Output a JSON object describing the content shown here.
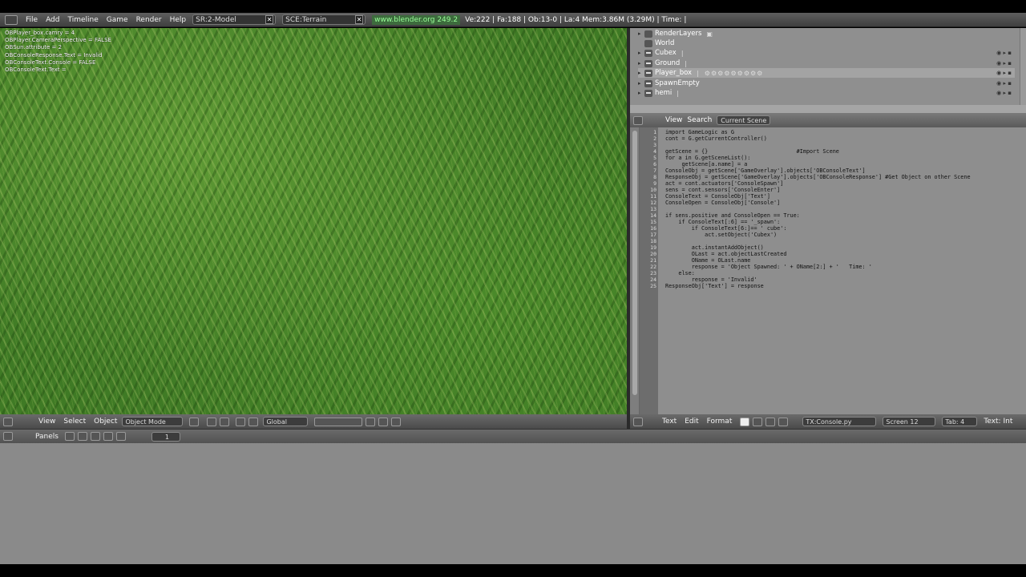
{
  "topbar": {
    "menus": [
      "File",
      "Add",
      "Timeline",
      "Game",
      "Render",
      "Help"
    ],
    "screen": "SR:2-Model",
    "scene": "SCE:Terrain",
    "url": "www.blender.org 249.2",
    "stats": "Ve:222 | Fa:188 | Ob:13-0 | La:4   Mem:3.86M (3.29M) | Time: |"
  },
  "viewport": {
    "debug_lines": [
      "OBPlayer_box.camry = 4",
      "OBPlayer.CameraPerspective = FALSE",
      "OBSun.attribute = 2",
      "OBConsoleResponse.Text = Invalid",
      "OBConsoleText.Console = FALSE",
      "OBConsoleText.Text ="
    ]
  },
  "outliner": {
    "items": [
      {
        "label": "RenderLayers",
        "extra": ""
      },
      {
        "label": "World",
        "extra": ""
      },
      {
        "label": "Cubex",
        "extra": "|"
      },
      {
        "label": "Ground",
        "extra": "|"
      },
      {
        "label": "Player_box",
        "extra": "|"
      },
      {
        "label": "SpawnEmpty",
        "extra": ""
      },
      {
        "label": "hemi",
        "extra": "|"
      }
    ]
  },
  "texteditor": {
    "header_buttons": [
      "View",
      "Search"
    ],
    "scope": "Current Scene",
    "lines": [
      {
        "n": "1",
        "code": "import GameLogic as G"
      },
      {
        "n": "2",
        "code": "cont = G.getCurrentController()"
      },
      {
        "n": "3",
        "code": ""
      },
      {
        "n": "4",
        "code": "getScene = {}                           #Import Scene"
      },
      {
        "n": "5",
        "code": "for a in G.getSceneList():"
      },
      {
        "n": "6",
        "code": "     getScene[a.name] = a"
      },
      {
        "n": "7",
        "code": "ConsoleObj = getScene['GameOverlay'].objects['OBConsoleText']"
      },
      {
        "n": "8",
        "code": "ResponseObj = getScene['GameOverlay'].objects['OBConsoleResponse'] #Get Object on other Scene"
      },
      {
        "n": "9",
        "code": "act = cont.actuators['ConsoleSpawn']"
      },
      {
        "n": "10",
        "code": "sens = cont.sensors['ConsoleEnter']"
      },
      {
        "n": "11",
        "code": "ConsoleText = ConsoleObj['Text']"
      },
      {
        "n": "12",
        "code": "ConsoleOpen = ConsoleObj['Console']"
      },
      {
        "n": "13",
        "code": ""
      },
      {
        "n": "14",
        "code": "if sens.positive and ConsoleOpen == True:"
      },
      {
        "n": "15",
        "code": "    if ConsoleText[:6] == '_spawn':"
      },
      {
        "n": "16",
        "code": "        if ConsoleText[6:]== ' cube':"
      },
      {
        "n": "17",
        "code": "            act.setObject('Cubex')"
      },
      {
        "n": "18",
        "code": ""
      },
      {
        "n": "19",
        "code": "        act.instantAddObject()"
      },
      {
        "n": "20",
        "code": "        OLast = act.objectLastCreated"
      },
      {
        "n": "21",
        "code": "        OName = OLast.name"
      },
      {
        "n": "22",
        "code": "        response = 'Object Spawned: ' + OName[2:] + '   Time: '"
      },
      {
        "n": "23",
        "code": "    else:"
      },
      {
        "n": "24",
        "code": "        response = 'Invalid'"
      },
      {
        "n": "25",
        "code": "ResponseObj['Text'] = response"
      }
    ],
    "footer": {
      "menus": [
        "Text",
        "Edit",
        "Format"
      ],
      "file": "TX:Console.py",
      "font": "Screen 12",
      "tab": "Tab: 4",
      "textlabel": "Text: Int"
    }
  },
  "viewport_header": {
    "menus": [
      "View",
      "Select",
      "Object"
    ],
    "mode": "Object Mode",
    "orientation": "Global"
  },
  "buttons_window": {
    "label": "Panels",
    "page": "1"
  }
}
